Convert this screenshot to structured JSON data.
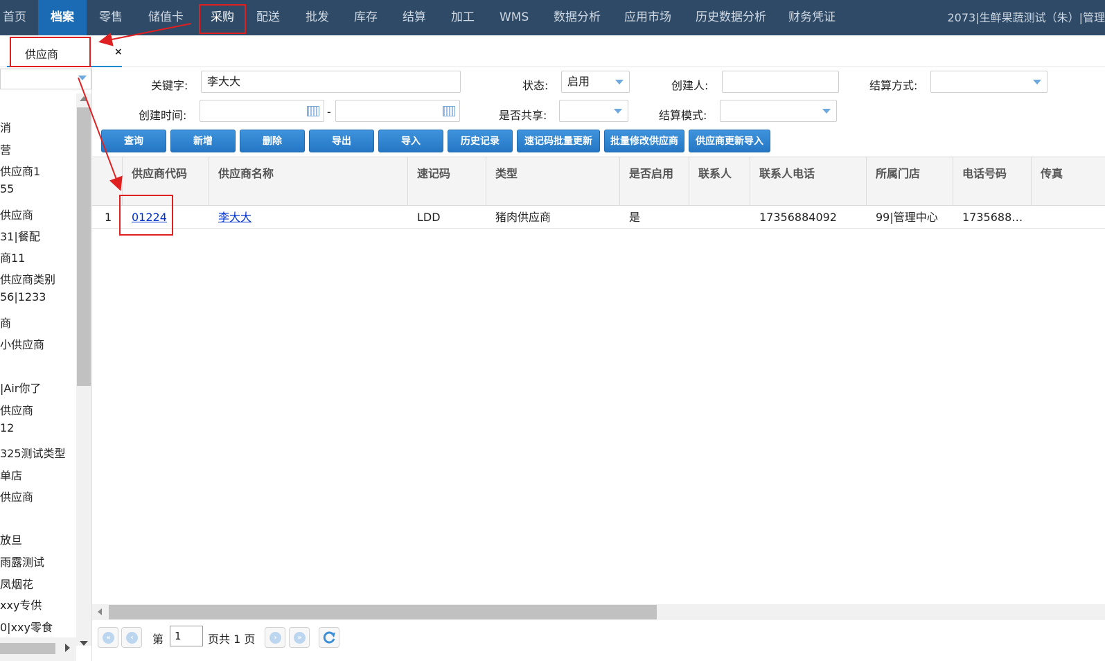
{
  "topnav": {
    "items": [
      "首页",
      "档案",
      "零售",
      "储值卡",
      "采购",
      "配送",
      "批发",
      "库存",
      "结算",
      "加工",
      "WMS",
      "数据分析",
      "应用市场",
      "历史数据分析",
      "财务凭证"
    ],
    "right_text": "2073|生鲜果蔬测试（朱）|管理"
  },
  "tab": {
    "label": "供应商",
    "close": "×"
  },
  "left_tree": {
    "items": [
      "消",
      "营",
      "供应商1",
      "55",
      "供应商",
      "31|餐配",
      "商11",
      "供应商类别",
      "56|1233",
      "商",
      "小供应商",
      "|Air你了",
      "供应商",
      "12",
      "325测试类型",
      "单店",
      "供应商",
      "放旦",
      "雨露测试",
      "凤烟花",
      "xxy专供",
      "0|xxy零食"
    ]
  },
  "filters": {
    "keyword_label": "关键字:",
    "keyword_value": "李大大",
    "status_label": "状态:",
    "status_value": "启用",
    "creator_label": "创建人:",
    "creator_value": "",
    "settle_method_label": "结算方式:",
    "settle_method_value": "",
    "create_time_label": "创建时间:",
    "time_sep": "-",
    "shared_label": "是否共享:",
    "shared_value": "",
    "settle_mode_label": "结算模式:",
    "settle_mode_value": ""
  },
  "buttons": [
    "查询",
    "新增",
    "删除",
    "导出",
    "导入",
    "历史记录",
    "速记码批量更新",
    "批量修改供应商",
    "供应商更新导入"
  ],
  "grid": {
    "columns": [
      "供应商代码",
      "供应商名称",
      "速记码",
      "类型",
      "是否启用",
      "联系人",
      "联系人电话",
      "所属门店",
      "电话号码",
      "传真"
    ],
    "rows": [
      {
        "index": "1",
        "code": "01224",
        "name": "李大大",
        "shortcode": "LDD",
        "type": "猪肉供应商",
        "enabled": "是",
        "contact": "",
        "contact_phone": "17356884092",
        "store": "99|管理中心",
        "phone": "1735688…",
        "fax": ""
      }
    ]
  },
  "pager": {
    "page_prefix": "第",
    "page_value": "1",
    "page_suffix": "页共 1 页"
  },
  "colors": {
    "nav_bg": "#2e4a66",
    "nav_active": "#1a6bb3",
    "button": "#2a7fcc",
    "annotation": "#e02020",
    "link": "#0033cc"
  },
  "icons": [
    "calendar-icon",
    "dropdown-arrow-icon",
    "close-icon",
    "first-page-icon",
    "prev-page-icon",
    "next-page-icon",
    "last-page-icon",
    "refresh-icon"
  ]
}
